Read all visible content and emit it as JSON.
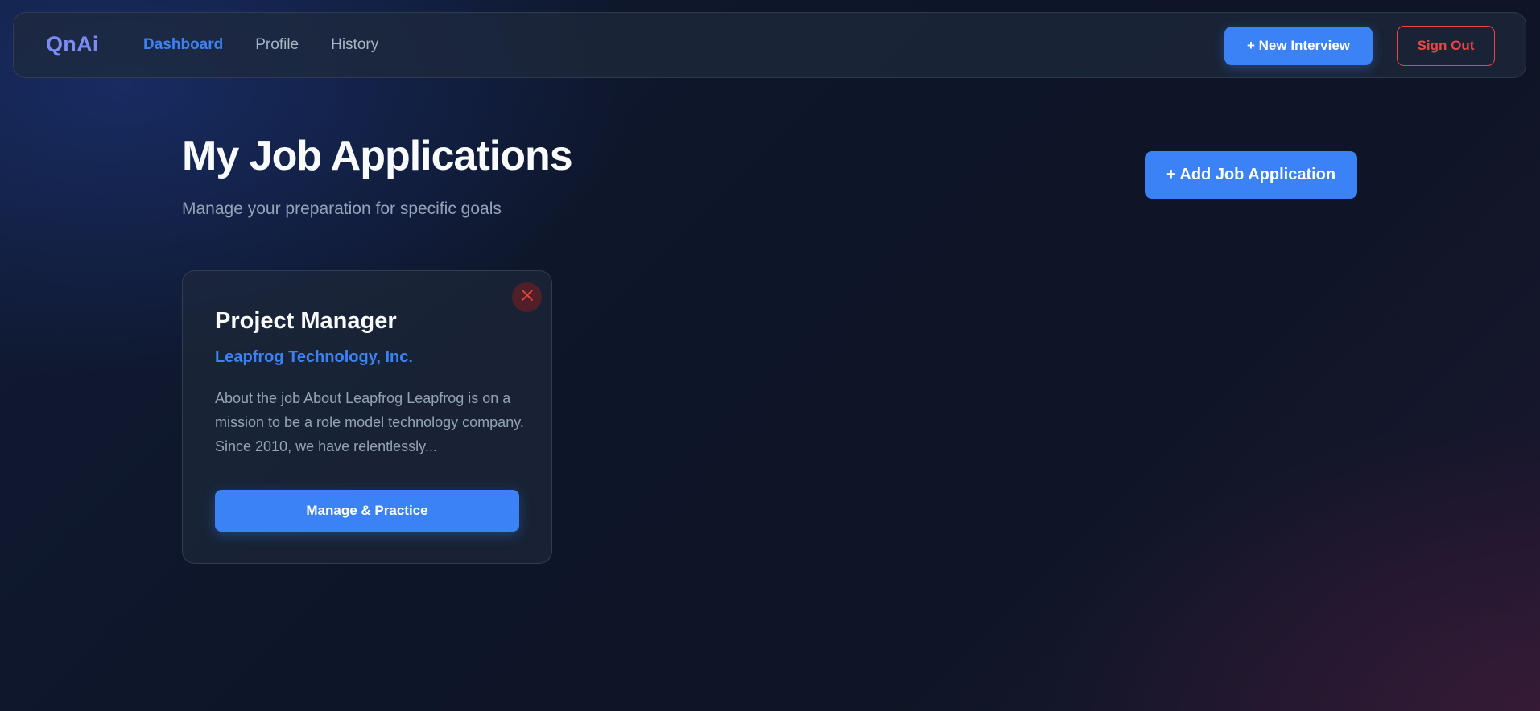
{
  "navbar": {
    "logo": "QnAi",
    "links": [
      {
        "label": "Dashboard",
        "active": true
      },
      {
        "label": "Profile",
        "active": false
      },
      {
        "label": "History",
        "active": false
      }
    ],
    "new_interview_label": "+ New Interview",
    "sign_out_label": "Sign Out"
  },
  "page": {
    "title": "My Job Applications",
    "subtitle": "Manage your preparation for specific goals",
    "add_button_label": "+ Add Job Application"
  },
  "applications": [
    {
      "title": "Project Manager",
      "company": "Leapfrog Technology, Inc.",
      "description": "About the job About Leapfrog Leapfrog is on a mission to be a role model technology company. Since 2010, we have relentlessly...",
      "action_label": "Manage & Practice",
      "delete_icon": "close-icon"
    }
  ],
  "colors": {
    "accent": "#3b82f6",
    "logo": "#7c8cf5",
    "danger": "#ef4444",
    "background": "#0f172a",
    "muted_text": "#94a3b8"
  }
}
